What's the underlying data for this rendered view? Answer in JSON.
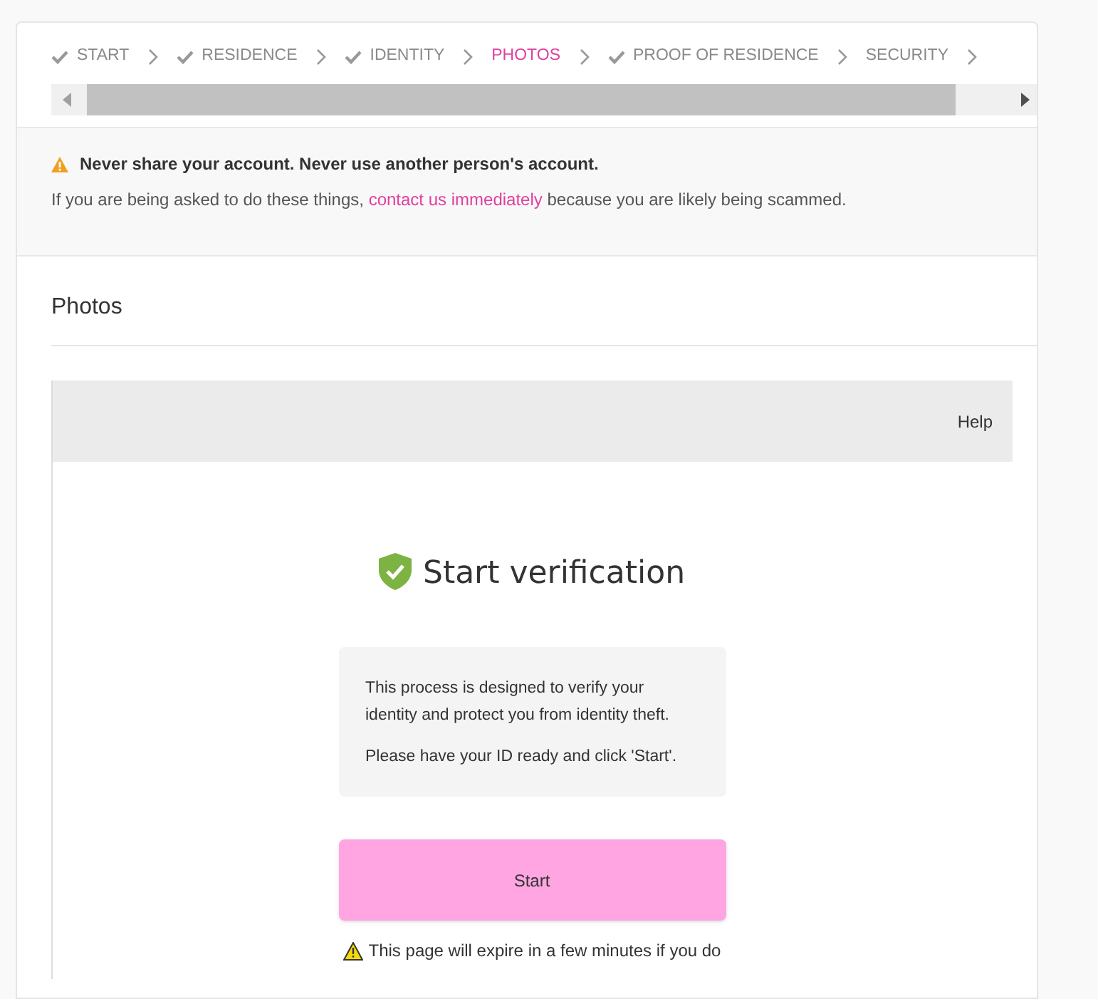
{
  "steps": [
    {
      "label": "START",
      "done": true,
      "selected": false
    },
    {
      "label": "RESIDENCE",
      "done": true,
      "selected": false
    },
    {
      "label": "IDENTITY",
      "done": true,
      "selected": false
    },
    {
      "label": "PHOTOS",
      "done": false,
      "selected": true
    },
    {
      "label": "PROOF OF RESIDENCE",
      "done": true,
      "selected": false
    },
    {
      "label": "SECURITY",
      "done": false,
      "selected": false
    }
  ],
  "warning": {
    "title": "Never share your account. Never use another person's account.",
    "text_before": "If you are being asked to do these things,",
    "link": "contact us immediately",
    "text_after": "because you are likely being scammed."
  },
  "section_title": "Photos",
  "verification": {
    "help": "Help",
    "title": "Start verification",
    "paragraphs": [
      "This process is designed to verify your identity and protect you from identity theft.",
      "Please have your ID ready and click 'Start'."
    ],
    "button": "Start",
    "expiry_note": "This page will expire in a few minutes if you do"
  }
}
